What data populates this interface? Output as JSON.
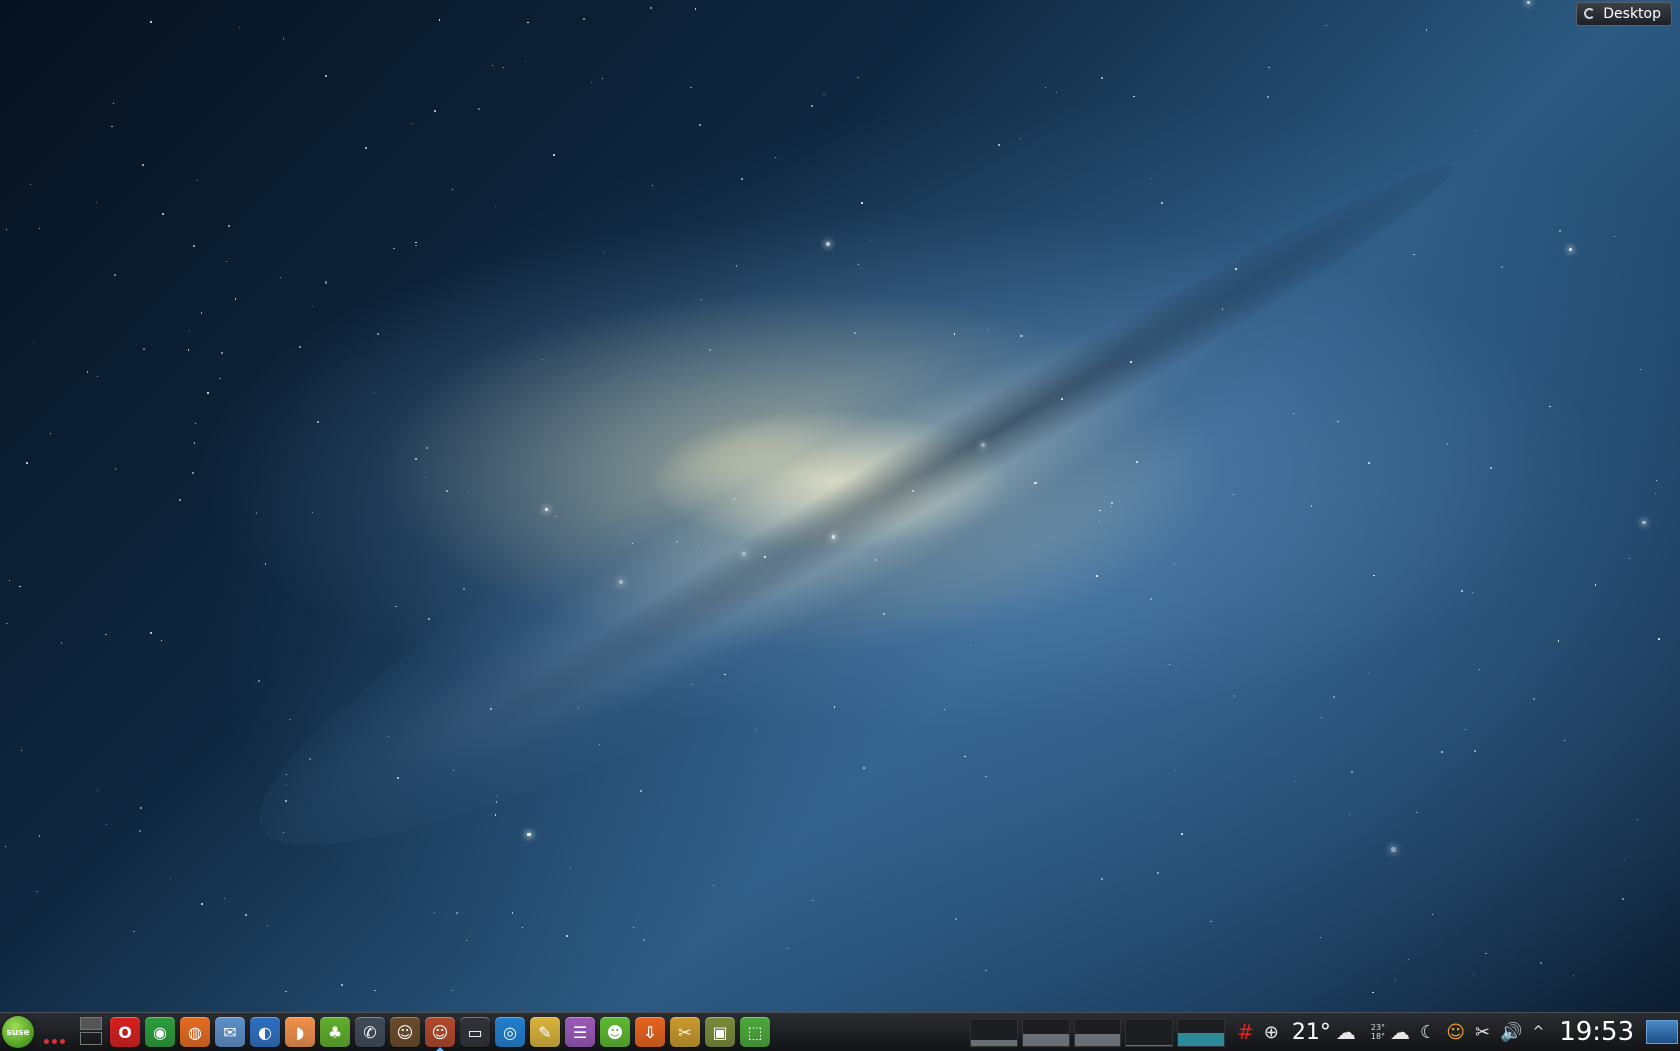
{
  "desktop": {
    "toolbox_label": "Desktop"
  },
  "taskbar": {
    "start_logo_text": "suse",
    "launchers": [
      {
        "name": "opera",
        "glyph": "O",
        "color": "#d81e1e",
        "running": false
      },
      {
        "name": "chrome",
        "glyph": "◉",
        "color": "#2b9c3a",
        "running": false
      },
      {
        "name": "firefox",
        "glyph": "◍",
        "color": "#e56b1f",
        "running": false
      },
      {
        "name": "mail",
        "glyph": "✉",
        "color": "#5d8fc9",
        "running": false
      },
      {
        "name": "browser",
        "glyph": "◐",
        "color": "#2d6fc2",
        "running": false
      },
      {
        "name": "app-orange",
        "glyph": "◗",
        "color": "#f0904a",
        "running": false
      },
      {
        "name": "evernote",
        "glyph": "♣",
        "color": "#5fae2b",
        "running": false
      },
      {
        "name": "chat",
        "glyph": "✆",
        "color": "#3f4a57",
        "running": false
      },
      {
        "name": "qq",
        "glyph": "☺",
        "color": "#6b4a2a",
        "running": false
      },
      {
        "name": "qq-2",
        "glyph": "☺",
        "color": "#b0482a",
        "running": true
      },
      {
        "name": "terminal",
        "glyph": "▭",
        "color": "#2e3238",
        "running": false
      },
      {
        "name": "app-blue",
        "glyph": "◎",
        "color": "#1f7fcf",
        "running": false
      },
      {
        "name": "text-editor",
        "glyph": "✎",
        "color": "#d9b33a",
        "running": false
      },
      {
        "name": "notes",
        "glyph": "☰",
        "color": "#9a58b8",
        "running": false
      },
      {
        "name": "app-face",
        "glyph": "☻",
        "color": "#5cb82e",
        "running": false
      },
      {
        "name": "downloader",
        "glyph": "⇩",
        "color": "#e8621c",
        "running": false
      },
      {
        "name": "tools",
        "glyph": "✂",
        "color": "#c99a2c",
        "running": false
      },
      {
        "name": "screen",
        "glyph": "▣",
        "color": "#7a8a3a",
        "running": false
      },
      {
        "name": "archive",
        "glyph": "⬚",
        "color": "#4aa83a",
        "running": false
      }
    ],
    "monitor": [
      {
        "name": "cpu",
        "level": 0.25
      },
      {
        "name": "memory",
        "level": 0.45
      },
      {
        "name": "swap",
        "level": 0.45
      },
      {
        "name": "disk",
        "level": 0.05
      },
      {
        "name": "net",
        "level": 0.5
      }
    ],
    "tray": {
      "temperature": "21°",
      "forecast_high": "23°",
      "forecast_low": "18°",
      "clock": "19:53"
    }
  }
}
